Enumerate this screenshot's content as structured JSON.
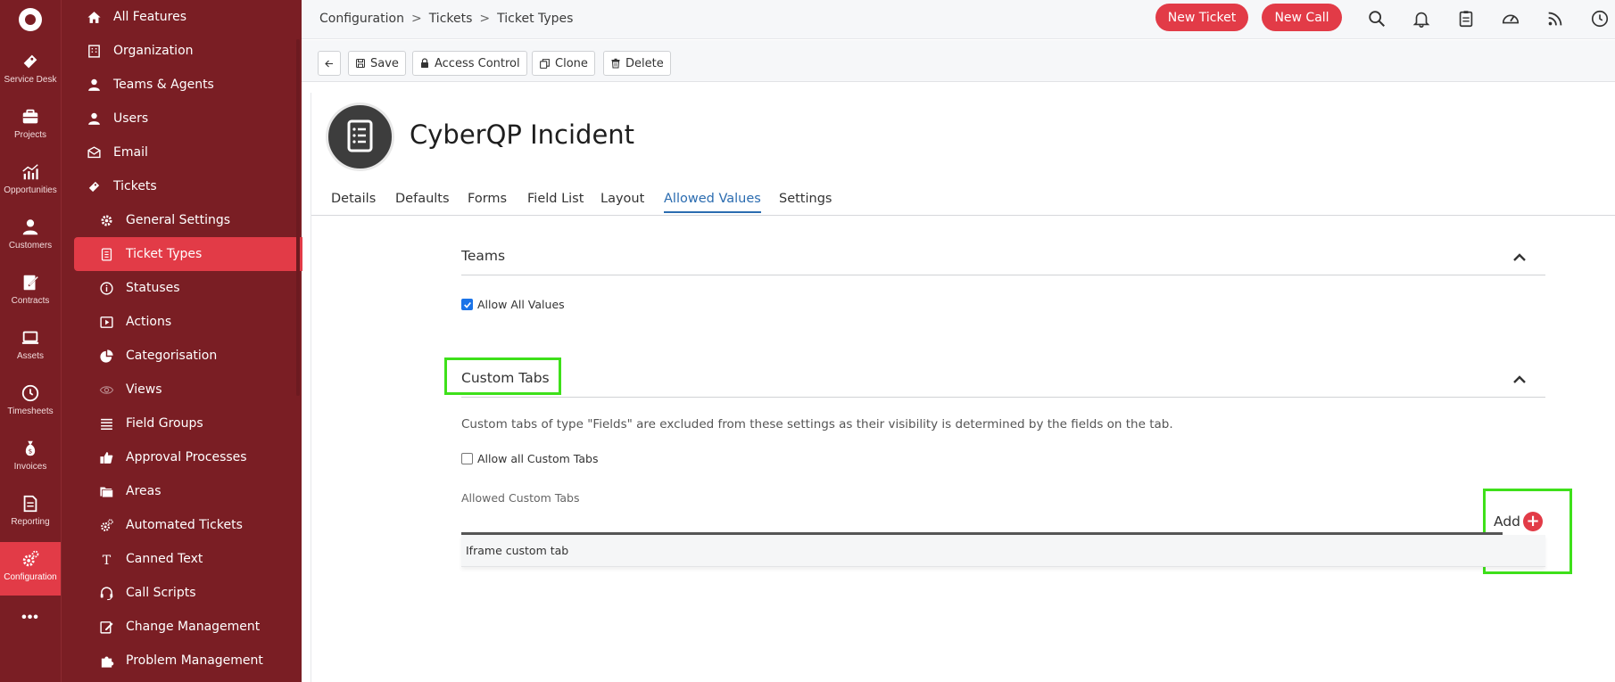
{
  "rail": {
    "items": [
      {
        "label": "Service Desk",
        "icon": "ticket-icon"
      },
      {
        "label": "Projects",
        "icon": "briefcase-icon"
      },
      {
        "label": "Opportunities",
        "icon": "chart-icon"
      },
      {
        "label": "Customers",
        "icon": "person-icon"
      },
      {
        "label": "Contracts",
        "icon": "contract-icon"
      },
      {
        "label": "Assets",
        "icon": "laptop-icon"
      },
      {
        "label": "Timesheets",
        "icon": "clock-icon"
      },
      {
        "label": "Invoices",
        "icon": "moneybag-icon"
      },
      {
        "label": "Reporting",
        "icon": "report-icon"
      },
      {
        "label": "Configuration",
        "icon": "gears-icon"
      }
    ],
    "active": "Configuration"
  },
  "menu": {
    "items": [
      {
        "label": "All Features",
        "icon": "home-icon"
      },
      {
        "label": "Organization",
        "icon": "building-icon"
      },
      {
        "label": "Teams & Agents",
        "icon": "person-icon"
      },
      {
        "label": "Users",
        "icon": "person-icon"
      },
      {
        "label": "Email",
        "icon": "mail-icon"
      },
      {
        "label": "Tickets",
        "icon": "ticket-icon"
      },
      {
        "label": "General Settings",
        "icon": "gear-icon"
      },
      {
        "label": "Ticket Types",
        "icon": "document-icon"
      },
      {
        "label": "Statuses",
        "icon": "info-icon"
      },
      {
        "label": "Actions",
        "icon": "play-icon"
      },
      {
        "label": "Categorisation",
        "icon": "pie-icon"
      },
      {
        "label": "Views",
        "icon": "eye-icon"
      },
      {
        "label": "Field Groups",
        "icon": "list-icon"
      },
      {
        "label": "Approval Processes",
        "icon": "thumbs-up-icon"
      },
      {
        "label": "Areas",
        "icon": "folder-icon"
      },
      {
        "label": "Automated Tickets",
        "icon": "gears-icon"
      },
      {
        "label": "Canned Text",
        "icon": "text-icon"
      },
      {
        "label": "Call Scripts",
        "icon": "headset-icon"
      },
      {
        "label": "Change Management",
        "icon": "edit-icon"
      },
      {
        "label": "Problem Management",
        "icon": "puzzle-icon"
      }
    ],
    "active": "Ticket Types"
  },
  "breadcrumb": [
    "Configuration",
    "Tickets",
    "Ticket Types"
  ],
  "header": {
    "new_ticket": "New Ticket",
    "new_call": "New Call",
    "icons": [
      "search-icon",
      "bell-icon",
      "clipboard-icon",
      "dashboard-icon",
      "rss-icon",
      "clock-icon"
    ]
  },
  "toolbar": {
    "save": "Save",
    "access_control": "Access Control",
    "clone": "Clone",
    "delete": "Delete"
  },
  "page": {
    "title": "CyberQP Incident",
    "tabs": [
      "Details",
      "Defaults",
      "Forms",
      "Field List",
      "Layout",
      "Allowed Values",
      "Settings"
    ],
    "active_tab": "Allowed Values"
  },
  "teams": {
    "title": "Teams",
    "allow_all_label": "Allow All Values",
    "allow_all_checked": true
  },
  "custom_tabs": {
    "title": "Custom Tabs",
    "description": "Custom tabs of type \"Fields\" are excluded from these settings as their visibility is determined by the fields on the tab.",
    "allow_all_label": "Allow all Custom Tabs",
    "allow_all_checked": false,
    "allowed_label": "Allowed Custom Tabs",
    "add_label": "Add",
    "rows": [
      "Iframe custom tab"
    ]
  },
  "colors": {
    "sidebar": "#7a1e24",
    "accent": "#e23b47",
    "link": "#2b6cb0",
    "highlight": "#3ee01a"
  }
}
